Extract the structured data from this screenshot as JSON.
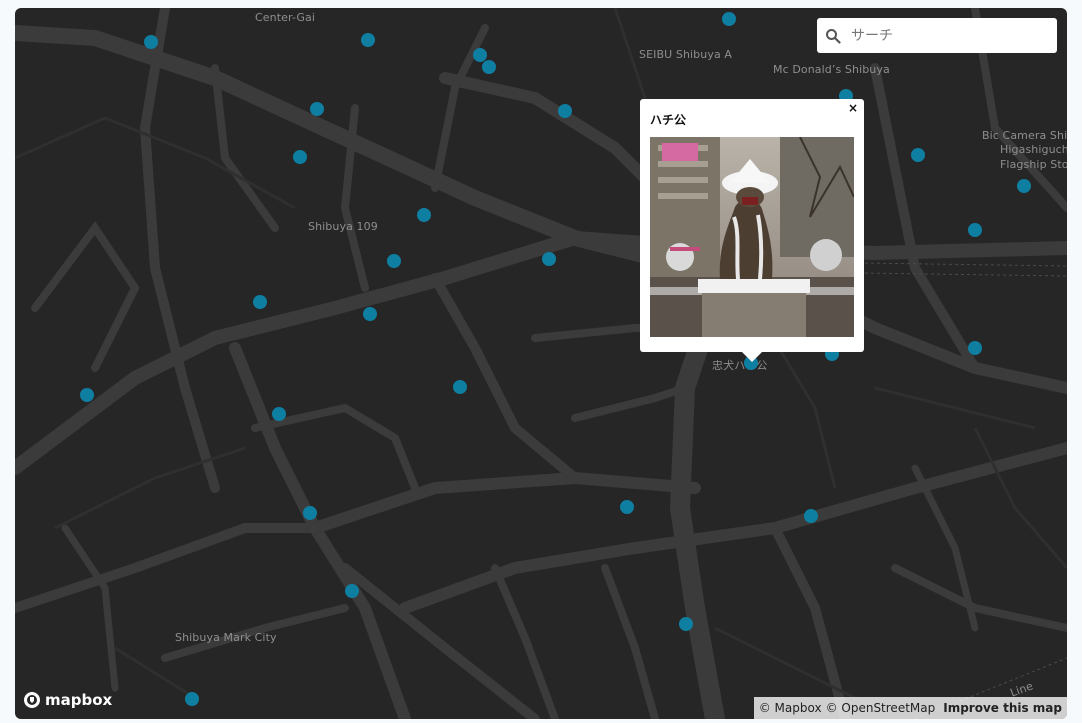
{
  "search": {
    "placeholder": "サーチ",
    "icon": "search-icon"
  },
  "popup": {
    "title": "ハチ公",
    "close_label": "×",
    "image": "hachiko-statue-in-snow"
  },
  "place_labels": [
    {
      "text": "Center-Gai"
    },
    {
      "text": "SEIBU Shibuya A"
    },
    {
      "text": "Mc Donald’s Shibuya"
    },
    {
      "text": "Bic Camera Shib"
    },
    {
      "text": "Higashiguchi"
    },
    {
      "text": "Flagship Store"
    },
    {
      "text": "Shibuya 109"
    },
    {
      "text": "忠犬ハチ公"
    },
    {
      "text": "Shibuya Mark City"
    },
    {
      "text": "Line"
    }
  ],
  "logo": {
    "text": "mapbox"
  },
  "attribution": {
    "mapbox": "© Mapbox",
    "osm": "© OpenStreetMap",
    "improve": "Improve this map"
  },
  "colors": {
    "map_bg": "#262626",
    "road": "#3a3a3a",
    "marker": "#0e7ea1",
    "label": "#8e8e8e"
  }
}
